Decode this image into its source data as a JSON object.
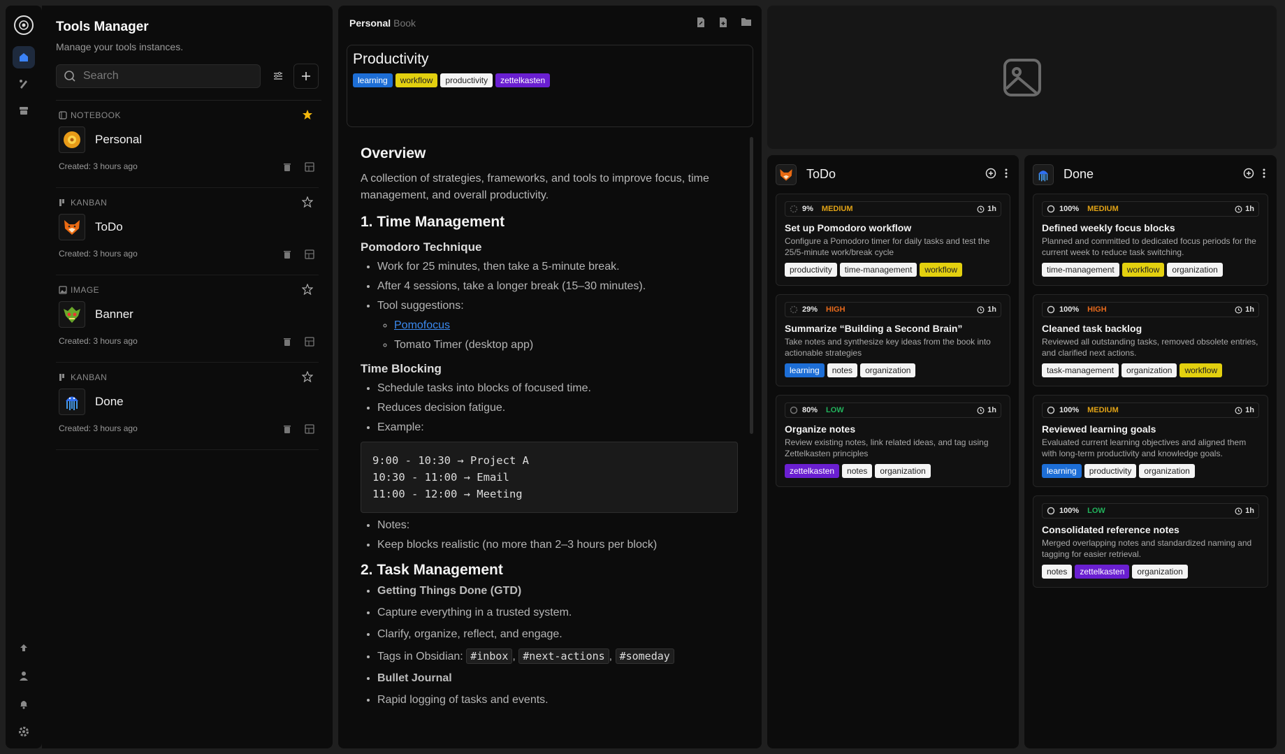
{
  "sidebar": {
    "title": "Tools Manager",
    "subtitle": "Manage your tools instances.",
    "search_placeholder": "Search",
    "items": [
      {
        "type": "NOTEBOOK",
        "name": "Personal",
        "created": "Created: 3 hours ago",
        "starred": true
      },
      {
        "type": "KANBAN",
        "name": "ToDo",
        "created": "Created: 3 hours ago",
        "starred": false
      },
      {
        "type": "IMAGE",
        "name": "Banner",
        "created": "Created: 3 hours ago",
        "starred": false
      },
      {
        "type": "KANBAN",
        "name": "Done",
        "created": "Created: 3 hours ago",
        "starred": false
      }
    ]
  },
  "note": {
    "crumb_main": "Personal",
    "crumb_sub": "Book",
    "title": "Productivity",
    "tags": [
      "learning",
      "workflow",
      "productivity",
      "zettelkasten"
    ],
    "overview_heading": "Overview",
    "overview_text": "A collection of strategies, frameworks, and tools to improve focus, time management, and overall productivity.",
    "s1_heading": "1. Time Management",
    "pomodoro_heading": "Pomodoro Technique",
    "pomodoro_items": [
      "Work for 25 minutes, then take a 5-minute break.",
      "After 4 sessions, take a longer break (15–30 minutes).",
      "Tool suggestions:"
    ],
    "tool_link": "Pomofocus",
    "tool_other": "Tomato Timer (desktop app)",
    "timeblock_heading": "Time Blocking",
    "timeblock_items": [
      "Schedule tasks into blocks of focused time.",
      "Reduces decision fatigue.",
      "Example:"
    ],
    "code_lines": [
      "9:00 - 10:30 → Project A",
      "10:30 - 11:00 → Email",
      "11:00 - 12:00 → Meeting"
    ],
    "after_code": [
      "Notes:",
      "Keep blocks realistic (no more than 2–3 hours per block)"
    ],
    "s2_heading": "2. Task Management",
    "gtd_heading": "Getting Things Done (GTD)",
    "gtd_items": [
      "Capture everything in a trusted system.",
      "Clarify, organize, reflect, and engage."
    ],
    "tags_label": "Tags in Obsidian:",
    "obsidian_tags": [
      "#inbox",
      "#next-actions",
      "#someday"
    ],
    "bujo_heading": "Bullet Journal",
    "bujo_item": "Rapid logging of tasks and events."
  },
  "todo": {
    "name": "ToDo",
    "cards": [
      {
        "progress": "9%",
        "priority": "MEDIUM",
        "duration": "1h",
        "title": "Set up Pomodoro workflow",
        "desc": "Configure a Pomodoro timer for daily tasks and test the 25/5-minute work/break cycle",
        "tags": [
          "productivity",
          "time-management",
          "workflow"
        ]
      },
      {
        "progress": "29%",
        "priority": "HIGH",
        "duration": "1h",
        "title": "Summarize “Building a Second Brain”",
        "desc": "Take notes and synthesize key ideas from the book into actionable strategies",
        "tags": [
          "learning",
          "notes",
          "organization"
        ]
      },
      {
        "progress": "80%",
        "priority": "LOW",
        "duration": "1h",
        "title": "Organize notes",
        "desc": "Review existing notes, link related ideas, and tag using Zettelkasten principles",
        "tags": [
          "zettelkasten",
          "notes",
          "organization"
        ]
      }
    ]
  },
  "done": {
    "name": "Done",
    "cards": [
      {
        "progress": "100%",
        "priority": "MEDIUM",
        "duration": "1h",
        "title": "Defined weekly focus blocks",
        "desc": "Planned and committed to dedicated focus periods for the current week to reduce task switching.",
        "tags": [
          "time-management",
          "workflow",
          "organization"
        ]
      },
      {
        "progress": "100%",
        "priority": "HIGH",
        "duration": "1h",
        "title": "Cleaned task backlog",
        "desc": "Reviewed all outstanding tasks, removed obsolete entries, and clarified next actions.",
        "tags": [
          "task-management",
          "organization",
          "workflow"
        ]
      },
      {
        "progress": "100%",
        "priority": "MEDIUM",
        "duration": "1h",
        "title": "Reviewed learning goals",
        "desc": "Evaluated current learning objectives and aligned them with long-term productivity and knowledge goals.",
        "tags": [
          "learning",
          "productivity",
          "organization"
        ]
      },
      {
        "progress": "100%",
        "priority": "LOW",
        "duration": "1h",
        "title": "Consolidated reference notes",
        "desc": "Merged overlapping notes and standardized naming and tagging for easier retrieval.",
        "tags": [
          "notes",
          "zettelkasten",
          "organization"
        ]
      }
    ]
  },
  "colors": {
    "accent": "#3b82f6",
    "bg": "#0c0c0c",
    "medium": "#e0a216",
    "high": "#e86a1c",
    "low": "#22b35c"
  }
}
